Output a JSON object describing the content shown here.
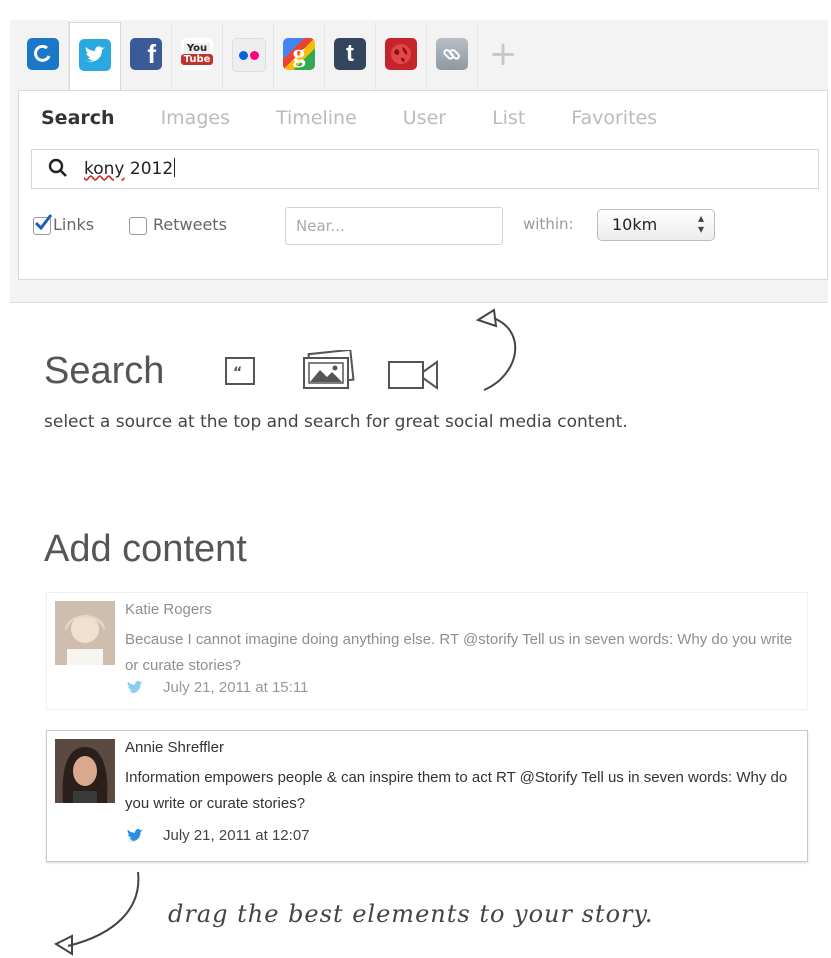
{
  "source_tabs": [
    {
      "icon": "storify-icon",
      "color": "#1b78c9"
    },
    {
      "icon": "twitter-icon",
      "color": "#2aa9e0",
      "active": true
    },
    {
      "icon": "facebook-icon",
      "color": "#3b5b98"
    },
    {
      "icon": "youtube-icon",
      "color": "#c4302b",
      "label_top": "You",
      "label_bottom": "Tube"
    },
    {
      "icon": "flickr-icon",
      "color": "#eeeeee"
    },
    {
      "icon": "google-icon",
      "color": "#4285f4"
    },
    {
      "icon": "tumblr-icon",
      "color": "#34465d",
      "glyph": "t"
    },
    {
      "icon": "web-globe-icon",
      "color": "#c4242a"
    },
    {
      "icon": "link-icon",
      "color": "#9aa3ab"
    },
    {
      "icon": "add-source-icon",
      "glyph": "+"
    }
  ],
  "subtabs": [
    "Search",
    "Images",
    "Timeline",
    "User",
    "List",
    "Favorites"
  ],
  "active_subtab": "Search",
  "search": {
    "query_underlined": "kony",
    "query_rest": " 2012"
  },
  "options": {
    "links_label": "Links",
    "links_checked": true,
    "retweets_label": "Retweets",
    "retweets_checked": false,
    "near_placeholder": "Near...",
    "within_label": "within:",
    "within_value": "10km"
  },
  "search_section": {
    "title": "Search",
    "icons": [
      "quote-icon",
      "image-icon",
      "video-icon"
    ],
    "description": "select a source at the top and search for great social media content."
  },
  "add_section": {
    "title": "Add content"
  },
  "tweets": [
    {
      "author": "Katie Rogers",
      "text": "Because I cannot imagine doing anything else. RT @storify Tell us in seven words: Why do you write or curate stories?",
      "date": "July 21, 2011 at 15:11"
    },
    {
      "author": "Annie Shreffler",
      "text": "Information empowers people & can inspire them to act RT @Storify Tell us in seven words: Why do you write or curate stories?",
      "date": "July 21, 2011 at 12:07"
    }
  ],
  "hint": "drag the best elements to your story."
}
